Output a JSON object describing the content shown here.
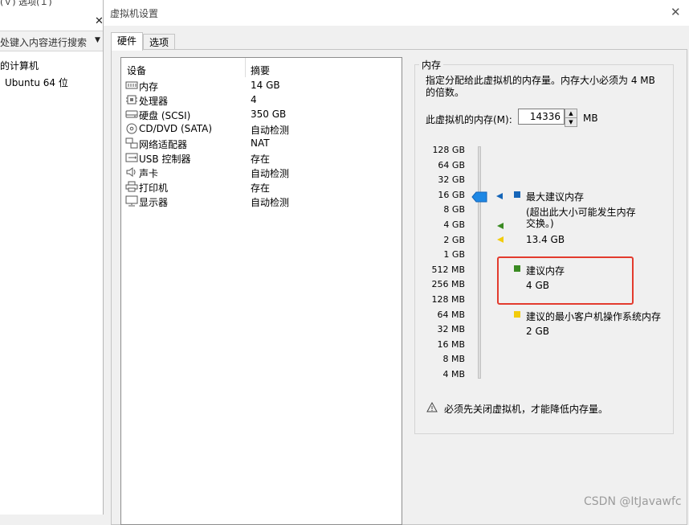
{
  "background_app": {
    "top_strip_text": "(Ｖ) 选项(Ｉ)",
    "close_glyph": "✕",
    "search_placeholder": "处键入内容进行搜索",
    "tree_title": "的计算机",
    "tree_item": "Ubuntu 64 位"
  },
  "dialog": {
    "title": "虚拟机设置",
    "close_glyph": "✕",
    "tabs": [
      {
        "label": "硬件",
        "active": true
      },
      {
        "label": "选项",
        "active": false
      }
    ]
  },
  "device_list": {
    "col_device": "设备",
    "col_summary": "摘要",
    "rows": [
      {
        "name": "内存",
        "summary": "14 GB",
        "icon": "memory-icon"
      },
      {
        "name": "处理器",
        "summary": "4",
        "icon": "processor-icon"
      },
      {
        "name": "硬盘 (SCSI)",
        "summary": "350 GB",
        "icon": "hard-disk-icon"
      },
      {
        "name": "CD/DVD (SATA)",
        "summary": "自动检测",
        "icon": "cd-dvd-icon"
      },
      {
        "name": "网络适配器",
        "summary": "NAT",
        "icon": "network-adapter-icon"
      },
      {
        "name": "USB 控制器",
        "summary": "存在",
        "icon": "usb-icon"
      },
      {
        "name": "声卡",
        "summary": "自动检测",
        "icon": "sound-card-icon"
      },
      {
        "name": "打印机",
        "summary": "存在",
        "icon": "printer-icon"
      },
      {
        "name": "显示器",
        "summary": "自动检测",
        "icon": "display-icon"
      }
    ]
  },
  "memory": {
    "group_title": "内存",
    "description": "指定分配给此虚拟机的内存量。内存大小必须为 4 MB 的倍数。",
    "field_label": "此虚拟机的内存(M):",
    "field_value": "14336",
    "unit": "MB",
    "scale_labels": [
      "128 GB",
      "64 GB",
      "32 GB",
      "16 GB",
      "8 GB",
      "4 GB",
      "2 GB",
      "1 GB",
      "512 MB",
      "256 MB",
      "128 MB",
      "64 MB",
      "32 MB",
      "16 MB",
      "8 MB",
      "4 MB"
    ],
    "max_recommended_label": "最大建议内存",
    "max_recommended_note": "(超出此大小可能发生内存交换。)",
    "max_recommended_value": "13.4 GB",
    "recommended_label": "建议内存",
    "recommended_value": "4 GB",
    "min_recommended_label": "建议的最小客户机操作系统内存",
    "min_recommended_value": "2 GB",
    "warning": "必须先关闭虚拟机，才能降低内存量。",
    "colors": {
      "max": "#1565b8",
      "recommended": "#3a8a22",
      "minimum": "#f2cc0c",
      "highlight": "#e33b2e"
    }
  },
  "watermark": "CSDN @ItJavawfc"
}
